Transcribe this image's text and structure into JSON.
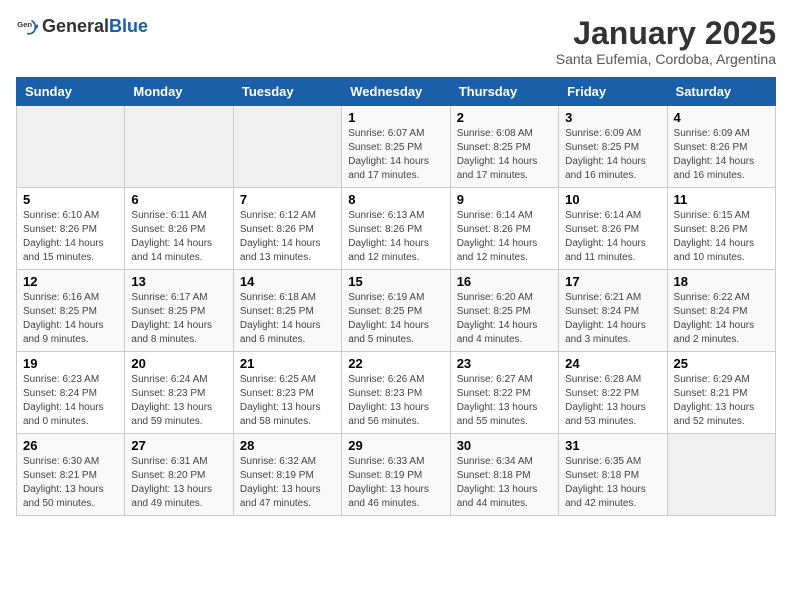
{
  "header": {
    "logo_general": "General",
    "logo_blue": "Blue",
    "month_title": "January 2025",
    "subtitle": "Santa Eufemia, Cordoba, Argentina"
  },
  "days_of_week": [
    "Sunday",
    "Monday",
    "Tuesday",
    "Wednesday",
    "Thursday",
    "Friday",
    "Saturday"
  ],
  "weeks": [
    [
      {
        "day": "",
        "sunrise": "",
        "sunset": "",
        "daylight": ""
      },
      {
        "day": "",
        "sunrise": "",
        "sunset": "",
        "daylight": ""
      },
      {
        "day": "",
        "sunrise": "",
        "sunset": "",
        "daylight": ""
      },
      {
        "day": "1",
        "sunrise": "6:07 AM",
        "sunset": "8:25 PM",
        "daylight": "14 hours and 17 minutes."
      },
      {
        "day": "2",
        "sunrise": "6:08 AM",
        "sunset": "8:25 PM",
        "daylight": "14 hours and 17 minutes."
      },
      {
        "day": "3",
        "sunrise": "6:09 AM",
        "sunset": "8:25 PM",
        "daylight": "14 hours and 16 minutes."
      },
      {
        "day": "4",
        "sunrise": "6:09 AM",
        "sunset": "8:26 PM",
        "daylight": "14 hours and 16 minutes."
      }
    ],
    [
      {
        "day": "5",
        "sunrise": "6:10 AM",
        "sunset": "8:26 PM",
        "daylight": "14 hours and 15 minutes."
      },
      {
        "day": "6",
        "sunrise": "6:11 AM",
        "sunset": "8:26 PM",
        "daylight": "14 hours and 14 minutes."
      },
      {
        "day": "7",
        "sunrise": "6:12 AM",
        "sunset": "8:26 PM",
        "daylight": "14 hours and 13 minutes."
      },
      {
        "day": "8",
        "sunrise": "6:13 AM",
        "sunset": "8:26 PM",
        "daylight": "14 hours and 12 minutes."
      },
      {
        "day": "9",
        "sunrise": "6:14 AM",
        "sunset": "8:26 PM",
        "daylight": "14 hours and 12 minutes."
      },
      {
        "day": "10",
        "sunrise": "6:14 AM",
        "sunset": "8:26 PM",
        "daylight": "14 hours and 11 minutes."
      },
      {
        "day": "11",
        "sunrise": "6:15 AM",
        "sunset": "8:26 PM",
        "daylight": "14 hours and 10 minutes."
      }
    ],
    [
      {
        "day": "12",
        "sunrise": "6:16 AM",
        "sunset": "8:25 PM",
        "daylight": "14 hours and 9 minutes."
      },
      {
        "day": "13",
        "sunrise": "6:17 AM",
        "sunset": "8:25 PM",
        "daylight": "14 hours and 8 minutes."
      },
      {
        "day": "14",
        "sunrise": "6:18 AM",
        "sunset": "8:25 PM",
        "daylight": "14 hours and 6 minutes."
      },
      {
        "day": "15",
        "sunrise": "6:19 AM",
        "sunset": "8:25 PM",
        "daylight": "14 hours and 5 minutes."
      },
      {
        "day": "16",
        "sunrise": "6:20 AM",
        "sunset": "8:25 PM",
        "daylight": "14 hours and 4 minutes."
      },
      {
        "day": "17",
        "sunrise": "6:21 AM",
        "sunset": "8:24 PM",
        "daylight": "14 hours and 3 minutes."
      },
      {
        "day": "18",
        "sunrise": "6:22 AM",
        "sunset": "8:24 PM",
        "daylight": "14 hours and 2 minutes."
      }
    ],
    [
      {
        "day": "19",
        "sunrise": "6:23 AM",
        "sunset": "8:24 PM",
        "daylight": "14 hours and 0 minutes."
      },
      {
        "day": "20",
        "sunrise": "6:24 AM",
        "sunset": "8:23 PM",
        "daylight": "13 hours and 59 minutes."
      },
      {
        "day": "21",
        "sunrise": "6:25 AM",
        "sunset": "8:23 PM",
        "daylight": "13 hours and 58 minutes."
      },
      {
        "day": "22",
        "sunrise": "6:26 AM",
        "sunset": "8:23 PM",
        "daylight": "13 hours and 56 minutes."
      },
      {
        "day": "23",
        "sunrise": "6:27 AM",
        "sunset": "8:22 PM",
        "daylight": "13 hours and 55 minutes."
      },
      {
        "day": "24",
        "sunrise": "6:28 AM",
        "sunset": "8:22 PM",
        "daylight": "13 hours and 53 minutes."
      },
      {
        "day": "25",
        "sunrise": "6:29 AM",
        "sunset": "8:21 PM",
        "daylight": "13 hours and 52 minutes."
      }
    ],
    [
      {
        "day": "26",
        "sunrise": "6:30 AM",
        "sunset": "8:21 PM",
        "daylight": "13 hours and 50 minutes."
      },
      {
        "day": "27",
        "sunrise": "6:31 AM",
        "sunset": "8:20 PM",
        "daylight": "13 hours and 49 minutes."
      },
      {
        "day": "28",
        "sunrise": "6:32 AM",
        "sunset": "8:19 PM",
        "daylight": "13 hours and 47 minutes."
      },
      {
        "day": "29",
        "sunrise": "6:33 AM",
        "sunset": "8:19 PM",
        "daylight": "13 hours and 46 minutes."
      },
      {
        "day": "30",
        "sunrise": "6:34 AM",
        "sunset": "8:18 PM",
        "daylight": "13 hours and 44 minutes."
      },
      {
        "day": "31",
        "sunrise": "6:35 AM",
        "sunset": "8:18 PM",
        "daylight": "13 hours and 42 minutes."
      },
      {
        "day": "",
        "sunrise": "",
        "sunset": "",
        "daylight": ""
      }
    ]
  ],
  "labels": {
    "sunrise_prefix": "Sunrise: ",
    "sunset_prefix": "Sunset: ",
    "daylight_prefix": "Daylight: "
  }
}
